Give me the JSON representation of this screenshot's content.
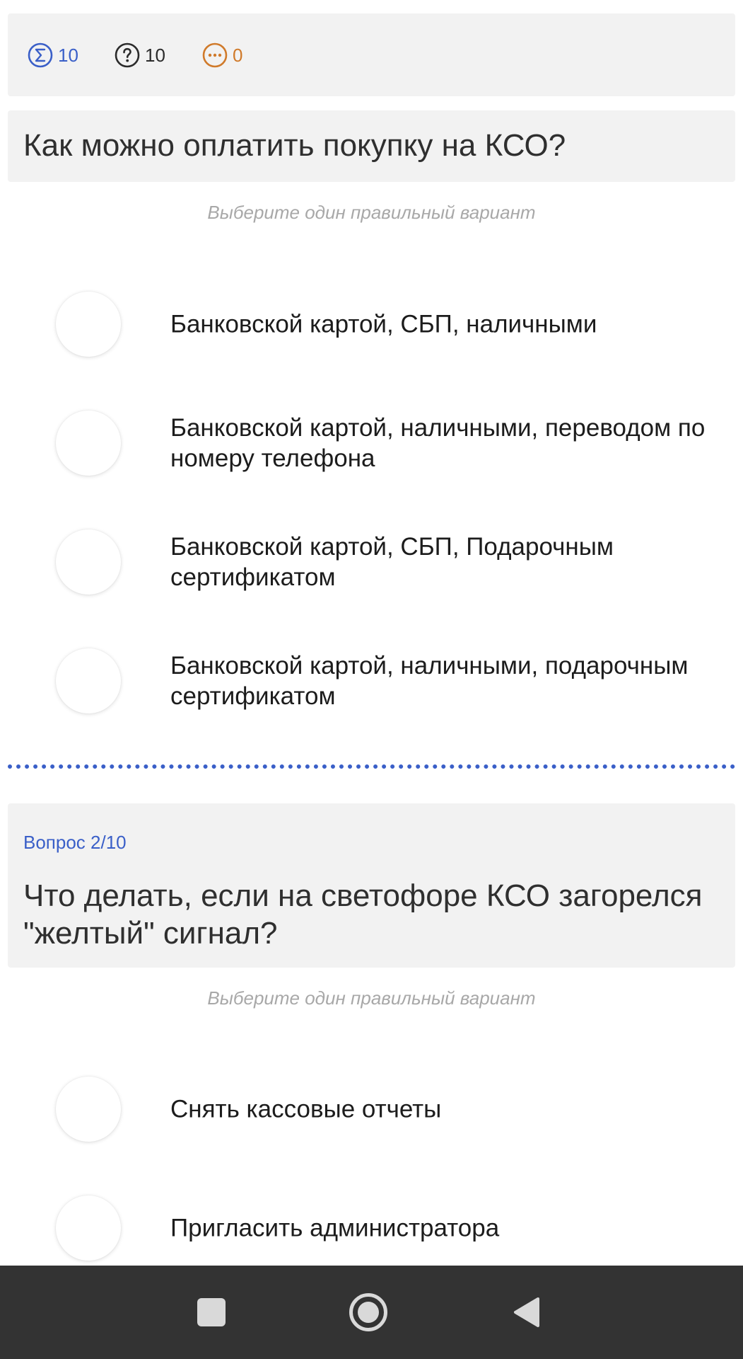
{
  "stats": {
    "total": "10",
    "questions": "10",
    "pending": "0"
  },
  "question1": {
    "text": "Как можно оплатить покупку на КСО?",
    "hint": "Выберите один правильный вариант",
    "options": [
      {
        "label": "Банковской картой, СБП, наличными"
      },
      {
        "label": "Банковской картой, наличными, переводом по номеру телефона"
      },
      {
        "label": "Банковской картой, СБП, Подарочным сертификатом"
      },
      {
        "label": "Банковской картой, наличными, подарочным сертификатом"
      }
    ]
  },
  "question2": {
    "counter": "Вопрос 2/10",
    "text": "Что делать, если на светофоре КСО загорелся \"желтый\" сигнал?",
    "hint": "Выберите один правильный вариант",
    "options": [
      {
        "label": "Снять кассовые отчеты"
      },
      {
        "label": "Пригласить администратора"
      }
    ]
  },
  "colors": {
    "accent": "#3a5fc8",
    "pending": "#d07a2a",
    "card_bg": "#f2f2f2",
    "nav_bg": "#333333"
  },
  "icons": {
    "total": "sigma-circle-icon",
    "questions": "question-circle-icon",
    "pending": "dots-circle-icon",
    "nav_recents": "square-icon",
    "nav_home": "circle-icon",
    "nav_back": "triangle-back-icon"
  }
}
